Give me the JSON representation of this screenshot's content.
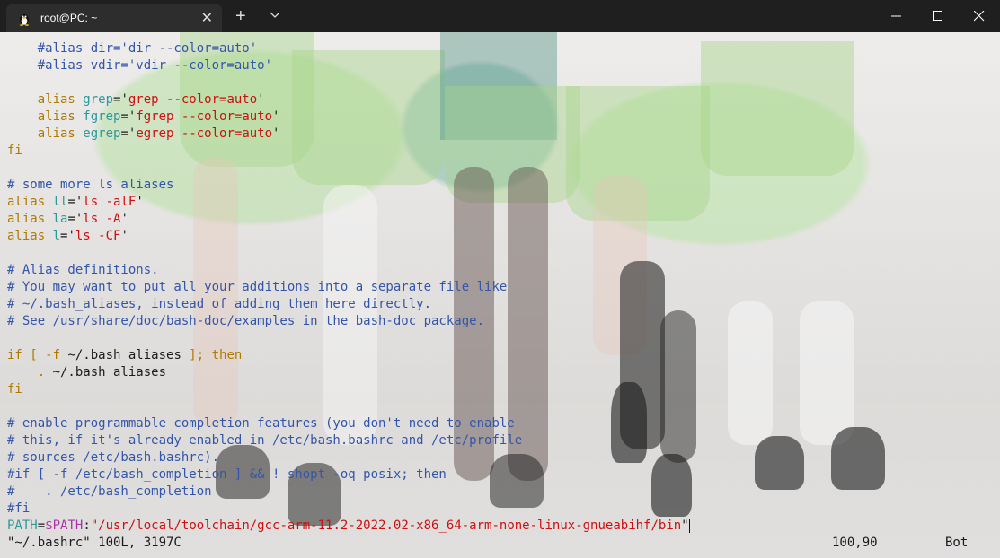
{
  "titlebar": {
    "tab_title": "root@PC: ~",
    "tab_icon": "linux-penguin-icon",
    "new_tab_symbol": "+",
    "close_tab_symbol": "✕"
  },
  "editor": {
    "lines": [
      [
        {
          "t": "    #alias dir='dir --color=auto'",
          "c": "comment"
        }
      ],
      [
        {
          "t": "    #alias vdir='vdir --color=auto'",
          "c": "comment"
        }
      ],
      [
        {
          "t": "",
          "c": "plain"
        }
      ],
      [
        {
          "t": "    alias ",
          "c": "kw"
        },
        {
          "t": "grep",
          "c": "id"
        },
        {
          "t": "='",
          "c": "plain"
        },
        {
          "t": "grep --color=auto",
          "c": "str"
        },
        {
          "t": "'",
          "c": "plain"
        }
      ],
      [
        {
          "t": "    alias ",
          "c": "kw"
        },
        {
          "t": "fgrep",
          "c": "id"
        },
        {
          "t": "='",
          "c": "plain"
        },
        {
          "t": "fgrep --color=auto",
          "c": "str"
        },
        {
          "t": "'",
          "c": "plain"
        }
      ],
      [
        {
          "t": "    alias ",
          "c": "kw"
        },
        {
          "t": "egrep",
          "c": "id"
        },
        {
          "t": "='",
          "c": "plain"
        },
        {
          "t": "egrep --color=auto",
          "c": "str"
        },
        {
          "t": "'",
          "c": "plain"
        }
      ],
      [
        {
          "t": "fi",
          "c": "kw"
        }
      ],
      [
        {
          "t": "",
          "c": "plain"
        }
      ],
      [
        {
          "t": "# some more ls aliases",
          "c": "comment"
        }
      ],
      [
        {
          "t": "alias ",
          "c": "kw"
        },
        {
          "t": "ll",
          "c": "id"
        },
        {
          "t": "='",
          "c": "plain"
        },
        {
          "t": "ls -alF",
          "c": "str"
        },
        {
          "t": "'",
          "c": "plain"
        }
      ],
      [
        {
          "t": "alias ",
          "c": "kw"
        },
        {
          "t": "la",
          "c": "id"
        },
        {
          "t": "='",
          "c": "plain"
        },
        {
          "t": "ls -A",
          "c": "str"
        },
        {
          "t": "'",
          "c": "plain"
        }
      ],
      [
        {
          "t": "alias ",
          "c": "kw"
        },
        {
          "t": "l",
          "c": "id"
        },
        {
          "t": "='",
          "c": "plain"
        },
        {
          "t": "ls -CF",
          "c": "str"
        },
        {
          "t": "'",
          "c": "plain"
        }
      ],
      [
        {
          "t": "",
          "c": "plain"
        }
      ],
      [
        {
          "t": "# Alias definitions.",
          "c": "comment"
        }
      ],
      [
        {
          "t": "# You may want to put all your additions into a separate file like",
          "c": "comment"
        }
      ],
      [
        {
          "t": "# ~/.bash_aliases, instead of adding them here directly.",
          "c": "comment"
        }
      ],
      [
        {
          "t": "# See /usr/share/doc/bash-doc/examples in the bash-doc package.",
          "c": "comment"
        }
      ],
      [
        {
          "t": "",
          "c": "plain"
        }
      ],
      [
        {
          "t": "if [ -f ",
          "c": "kw"
        },
        {
          "t": "~/.bash_aliases",
          "c": "plain"
        },
        {
          "t": " ]; then",
          "c": "kw"
        }
      ],
      [
        {
          "t": "    . ",
          "c": "kw"
        },
        {
          "t": "~/.bash_aliases",
          "c": "plain"
        }
      ],
      [
        {
          "t": "fi",
          "c": "kw"
        }
      ],
      [
        {
          "t": "",
          "c": "plain"
        }
      ],
      [
        {
          "t": "# enable programmable completion features (you don't need to enable",
          "c": "comment"
        }
      ],
      [
        {
          "t": "# this, if it's already enabled in /etc/bash.bashrc and /etc/profile",
          "c": "comment"
        }
      ],
      [
        {
          "t": "# sources /etc/bash.bashrc).",
          "c": "comment"
        }
      ],
      [
        {
          "t": "#if [ -f /etc/bash_completion ] && ! shopt -oq posix; then",
          "c": "comment"
        }
      ],
      [
        {
          "t": "#    . /etc/bash_completion",
          "c": "comment"
        }
      ],
      [
        {
          "t": "#fi",
          "c": "comment"
        }
      ],
      [
        {
          "t": "PATH",
          "c": "id"
        },
        {
          "t": "=",
          "c": "plain"
        },
        {
          "t": "$PATH",
          "c": "var"
        },
        {
          "t": ":",
          "c": "plain"
        },
        {
          "t": "\"/usr/local/toolchain/gcc-arm-11.2-2022.02-x86_64-arm-none-linux-gnueabihf/bin",
          "c": "path"
        },
        {
          "t": "\"",
          "c": "plain"
        }
      ]
    ],
    "status": {
      "file_info": "\"~/.bashrc\" 100L, 3197C",
      "cursor_position": "100,90",
      "scroll_position": "Bot"
    }
  },
  "colors": {
    "comment": "#3355aa",
    "keyword": "#b07a00",
    "string": "#cc1111",
    "identifier": "#2a9a9a",
    "variable": "#aa33aa",
    "titlebar": "#1f1f1f",
    "tab": "#2d2d2d"
  }
}
